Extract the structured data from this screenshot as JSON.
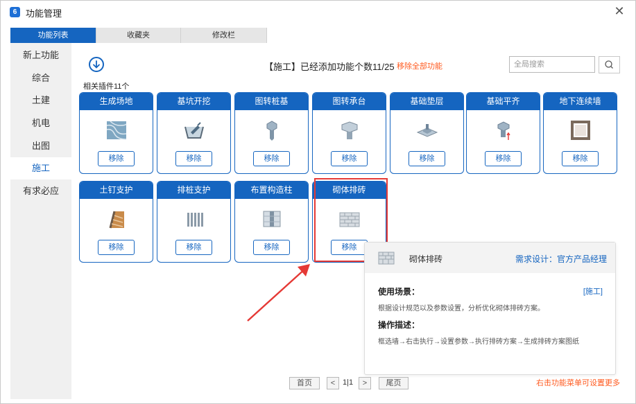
{
  "window": {
    "title": "功能管理",
    "app_icon": "6"
  },
  "tabs": [
    {
      "label": "功能列表",
      "active": true
    },
    {
      "label": "收藏夹",
      "active": false
    },
    {
      "label": "修改栏",
      "active": false
    }
  ],
  "nav": [
    {
      "label": "新上功能"
    },
    {
      "label": "综合"
    },
    {
      "label": "土建"
    },
    {
      "label": "机电"
    },
    {
      "label": "出图"
    },
    {
      "label": "施工",
      "active": true
    },
    {
      "label": "有求必应"
    }
  ],
  "header": {
    "info_text": "【施工】已经添加功能个数11/25",
    "remove_all": "移除全部功能",
    "search_placeholder": "全局搜索",
    "plugin_count": "相关插件11个"
  },
  "cards": [
    {
      "name": "生成场地",
      "icon": "terrain-icon",
      "button": "移除"
    },
    {
      "name": "基坑开挖",
      "icon": "excavation-icon",
      "button": "移除"
    },
    {
      "name": "图转桩基",
      "icon": "pile-foundation-icon",
      "button": "移除"
    },
    {
      "name": "图转承台",
      "icon": "pile-cap-icon",
      "button": "移除"
    },
    {
      "name": "基础垫层",
      "icon": "cushion-layer-icon",
      "button": "移除"
    },
    {
      "name": "基础平齐",
      "icon": "foundation-align-icon",
      "button": "移除"
    },
    {
      "name": "地下连续墙",
      "icon": "diaphragm-wall-icon",
      "button": "移除"
    },
    {
      "name": "土钉支护",
      "icon": "soil-nail-icon",
      "button": "移除"
    },
    {
      "name": "排桩支护",
      "icon": "pile-row-icon",
      "button": "移除"
    },
    {
      "name": "布置构造柱",
      "icon": "structural-column-icon",
      "button": "移除"
    },
    {
      "name": "砌体排砖",
      "icon": "brick-layout-icon",
      "button": "移除"
    }
  ],
  "tooltip": {
    "title": "砌体排砖",
    "demand": "需求设计：官方产品经理",
    "usage_label": "使用场景：",
    "tag": "[施工]",
    "usage_text": "根据设计规范以及参数设置，分析优化砌体排砖方案。",
    "operation_label": "操作描述：",
    "operation_text": "框选墙→右击执行→设置参数→执行排砖方案→生成排砖方案图纸"
  },
  "pagination": {
    "first": "首页",
    "prev": "<",
    "page_info": "1|1",
    "next": ">",
    "last": "尾页"
  },
  "footer_hint": "右击功能菜单可设置更多",
  "colors": {
    "primary": "#1565c0",
    "accent_orange": "#ff5a1f",
    "highlight_red": "#e53935"
  }
}
